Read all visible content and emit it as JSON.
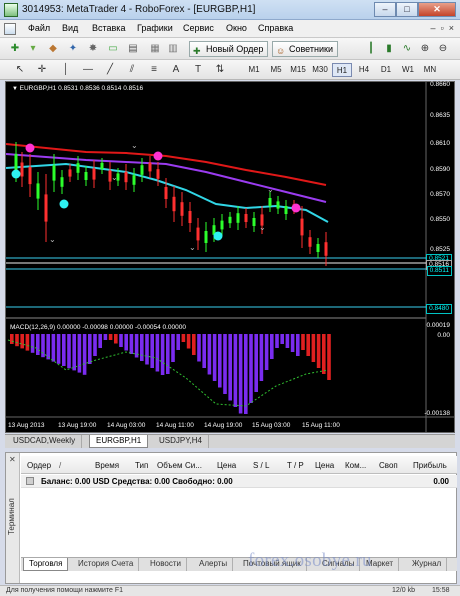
{
  "window": {
    "title": "3014953: MetaTrader 4 - RoboForex - [EURGBP,H1]",
    "min": "‒",
    "max": "□",
    "close": "✕"
  },
  "menu": [
    "Файл",
    "Вид",
    "Вставка",
    "Графики",
    "Сервис",
    "Окно",
    "Справка"
  ],
  "mdi_controls": [
    "–",
    "▫",
    "×"
  ],
  "toolbar": {
    "new_order": "Новый Ордер",
    "advisors": "Советники"
  },
  "timeframes": [
    "M1",
    "M5",
    "M15",
    "M30",
    "H1",
    "H4",
    "D1",
    "W1",
    "MN"
  ],
  "active_timeframe": "H1",
  "chart": {
    "header": "EURGBP,H1  0.8531 0.8536 0.8514 0.8516",
    "macd_label": "MACD(12,26,9) 0.00000 -0.00098 0.00000 -0.00054 0.00000",
    "price_ticks": [
      "0.8660",
      "0.8635",
      "0.8610",
      "0.8590",
      "0.8570",
      "0.8550",
      "0.8525"
    ],
    "price_boxes": [
      "0.8521",
      "0.8516",
      "0.8511",
      "0.8480"
    ],
    "macd_ticks": [
      "0.00019",
      "0.00",
      "-0.00138"
    ],
    "time_ticks": [
      "13 Aug 2013",
      "13 Aug 19:00",
      "14 Aug 03:00",
      "14 Aug 11:00",
      "14 Aug 19:00",
      "15 Aug 03:00",
      "15 Aug 11:00"
    ]
  },
  "chart_tabs": [
    "USDCAD,Weekly",
    "EURGBP,H1",
    "USDJPY,H4"
  ],
  "active_chart_tab": "EURGBP,H1",
  "terminal": {
    "side_label": "Терминал",
    "columns": [
      "Ордер",
      "Время",
      "Тип",
      "Объем",
      "Си...",
      "Цена",
      "S / L",
      "T / P",
      "Цена",
      "Ком...",
      "Своп",
      "Прибыль"
    ],
    "balance_row": "Баланс: 0.00 USD  Средства: 0.00  Свободно: 0.00",
    "profit": "0.00",
    "tabs": [
      "Торговля",
      "История Счета",
      "Новости",
      "Алерты",
      "Почтовый ящик",
      "Сигналы",
      "Маркет",
      "Журнал"
    ],
    "active_tab": "Торговля"
  },
  "statusbar": {
    "left": "Для получения помощи нажмите F1",
    "right": "15:58",
    "kb": "12/0 kb"
  },
  "watermark": "forex.osobye.ru",
  "colors": {
    "ema_red": "#e01818",
    "ema_purple": "#9a3cf0",
    "ema_cyan": "#31d6e6",
    "macd_red": "#e02020",
    "macd_purple": "#7a2cf0",
    "dot_magenta": "#ff33d2",
    "dot_cyan": "#2ef2f2"
  }
}
